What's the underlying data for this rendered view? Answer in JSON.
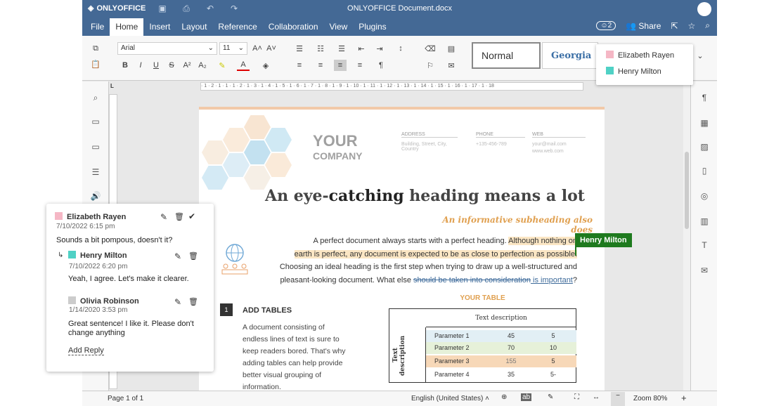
{
  "app": {
    "logo": "ONLYOFFICE",
    "title": "ONLYOFFICE Document.docx"
  },
  "menu": {
    "items": [
      "File",
      "Home",
      "Insert",
      "Layout",
      "Reference",
      "Collaboration",
      "View",
      "Plugins"
    ],
    "active": "Home",
    "users_count": "2",
    "share": "Share"
  },
  "toolbar": {
    "font": "Arial",
    "size": "11",
    "style_normal": "Normal",
    "style_georgia": "Georgia"
  },
  "users": [
    {
      "name": "Elizabeth Rayen",
      "color": "#f5b7c5"
    },
    {
      "name": "Henry Milton",
      "color": "#4fd1c5"
    }
  ],
  "doc": {
    "company_1": "YOUR",
    "company_2": "COMPANY",
    "h_address": "ADDRESS",
    "address": "Building, Street, City, Country",
    "h_phone": "PHONE",
    "phone": "+135-456-789",
    "h_web": "WEB",
    "web_1": "your@mail.com",
    "web_2": "www.web.com",
    "heading_a": "An eye-",
    "heading_b": "catching",
    "heading_c": " heading means a lot",
    "subheading": "An informative subheading also does",
    "p_line1a": "A perfect document always starts with a perfect heading. ",
    "p_line1b": "Although nothing on",
    "p_line2": "earth is perfect, any document is expected to be as close to perfection as possible.",
    "p_line3": "Choosing an ideal heading is the first step when trying to draw up a well-structured and",
    "p_line4a": "pleasant-looking document. What else ",
    "p_line4b": "should be taken into consideration",
    "p_line4c": " is important",
    "p_line4d": "?",
    "cursor_label": "Henry Milton",
    "num": "1",
    "add_tables": "ADD TABLES",
    "tables_text": [
      "A document consisting of",
      "endless lines of text is sure to",
      "keep readers bored. That's why",
      "adding tables can help provide",
      "better visual grouping of",
      "information."
    ],
    "your_table": "YOUR TABLE",
    "table": {
      "header": "Text description",
      "side": "Text description",
      "rows": [
        {
          "label": "Parameter 1",
          "a": "45",
          "b": "5"
        },
        {
          "label": "Parameter 2",
          "a": "70",
          "b": "10"
        },
        {
          "label": "Parameter 3",
          "a": "155",
          "b": "5"
        },
        {
          "label": "Parameter 4",
          "a": "35",
          "b": "5-"
        }
      ]
    }
  },
  "comments": [
    {
      "name": "Elizabeth Rayen",
      "date": "7/10/2022  6:15 pm",
      "text": "Sounds a bit pompous, doesn't it?"
    },
    {
      "name": "Henry Milton",
      "date": "7/10/2022  6:20 pm",
      "text": "Yeah, I agree. Let's make it clearer."
    },
    {
      "name": "Olivia Robinson",
      "date": "1/14/2020  3:53 pm",
      "text": "Great sentence! I like it. Please don't change anything"
    }
  ],
  "add_reply": "Add Reply",
  "status": {
    "page": "Page 1 of 1",
    "language": "English (United States)",
    "zoom": "Zoom 80%"
  }
}
